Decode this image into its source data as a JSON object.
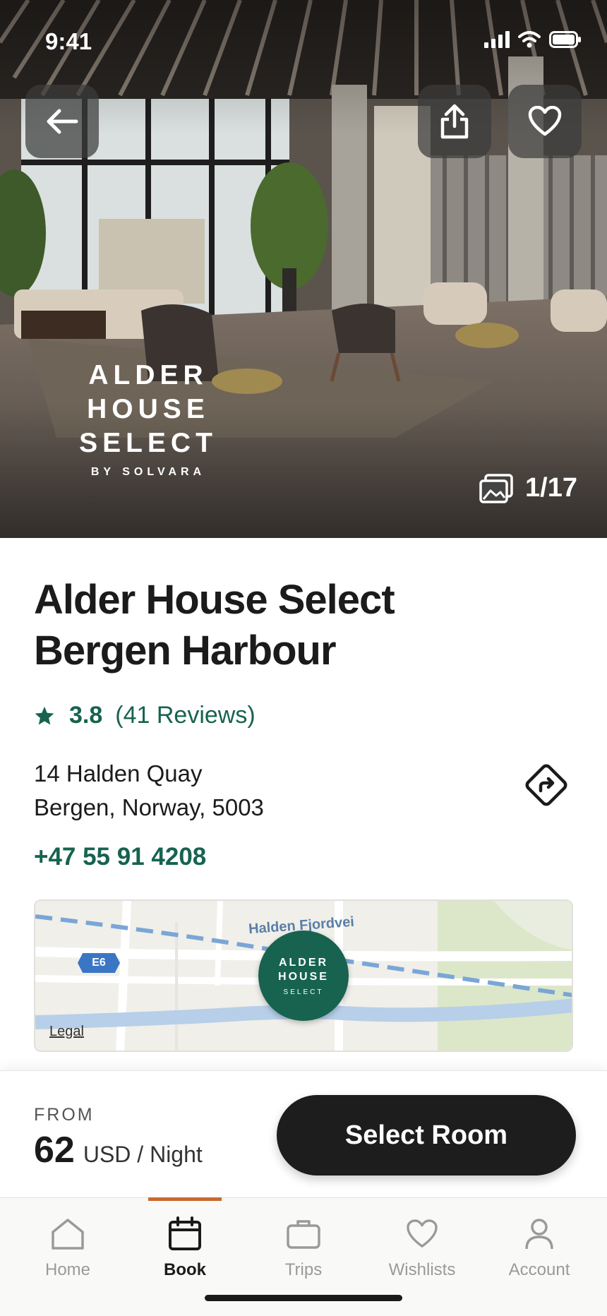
{
  "status_bar": {
    "time": "9:41"
  },
  "hero": {
    "logo_line1": "ALDER HOUSE",
    "logo_line2": "SELECT",
    "logo_line3": "BY SOLVARA",
    "photo_counter": "1/17"
  },
  "hotel": {
    "name_line1": "Alder House Select",
    "name_line2": "Bergen Harbour",
    "rating": "3.8",
    "reviews": "(41 Reviews)",
    "address_line1": "14 Halden Quay",
    "address_line2": "Bergen, Norway, 5003",
    "phone": "+47 55 91 4208"
  },
  "map": {
    "road_label": "Halden Fjordvei",
    "route_shield": "E6",
    "pin_line1": "ALDER",
    "pin_line2": "HOUSE",
    "pin_line3": "SELECT",
    "legal": "Legal"
  },
  "booking": {
    "from_label": "FROM",
    "price": "62",
    "unit": "USD / Night",
    "cta": "Select Room"
  },
  "tabs": [
    {
      "label": "Home",
      "icon": "home-icon",
      "active": false
    },
    {
      "label": "Book",
      "icon": "calendar-icon",
      "active": true
    },
    {
      "label": "Trips",
      "icon": "briefcase-icon",
      "active": false
    },
    {
      "label": "Wishlists",
      "icon": "heart-icon",
      "active": false
    },
    {
      "label": "Account",
      "icon": "person-icon",
      "active": false
    }
  ],
  "colors": {
    "accent_green": "#17634f",
    "tab_indicator": "#c96a2e",
    "cta_bg": "#1d1d1d"
  }
}
